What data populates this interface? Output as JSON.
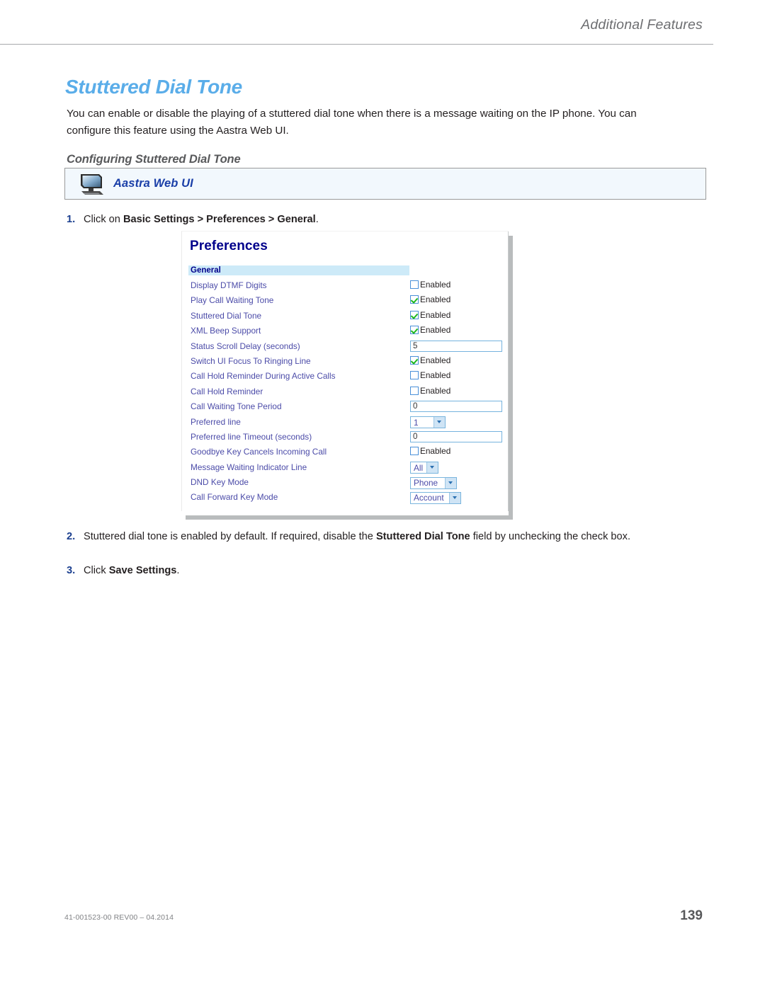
{
  "header": {
    "running_head": "Additional Features"
  },
  "page": {
    "title": "Stuttered Dial Tone",
    "intro": "You can enable or disable the playing of a stuttered dial tone when there is a message waiting on the IP phone. You can configure this feature using the Aastra Web UI.",
    "sub_head": "Configuring Stuttered Dial Tone"
  },
  "callout": {
    "icon": "computer-monitor-icon",
    "label": "Aastra Web UI"
  },
  "steps": [
    {
      "num": "1.",
      "parts": [
        {
          "text": "Click on ",
          "bold": false
        },
        {
          "text": "Basic Settings > Preferences > General",
          "bold": true
        },
        {
          "text": ".",
          "bold": false
        }
      ]
    },
    {
      "num": "2.",
      "parts": [
        {
          "text": "Stuttered dial tone is enabled by default. If required, disable the ",
          "bold": false
        },
        {
          "text": "Stuttered Dial Tone",
          "bold": true
        },
        {
          "text": " field by unchecking the check box.",
          "bold": false
        }
      ]
    },
    {
      "num": "3.",
      "parts": [
        {
          "text": "Click ",
          "bold": false
        },
        {
          "text": "Save Settings",
          "bold": true
        },
        {
          "text": ".",
          "bold": false
        }
      ]
    }
  ],
  "step1": {
    "num": "1.",
    "pre": "Click on ",
    "bold": "Basic Settings > Preferences > General",
    "post": "."
  },
  "step2": {
    "num": "2.",
    "pre": "Stuttered dial tone is enabled by default. If required, disable the ",
    "bold": "Stuttered Dial Tone",
    "post": " field by unchecking the check box."
  },
  "step3": {
    "num": "3.",
    "pre": "Click ",
    "bold": "Save Settings",
    "post": "."
  },
  "screenshot": {
    "title": "Preferences",
    "section": "General",
    "enabled_label": "Enabled",
    "rows": [
      {
        "label": "Display DTMF Digits",
        "type": "checkbox",
        "checked": false,
        "value": "Enabled"
      },
      {
        "label": "Play Call Waiting Tone",
        "type": "checkbox",
        "checked": true,
        "value": "Enabled"
      },
      {
        "label": "Stuttered Dial Tone",
        "type": "checkbox",
        "checked": true,
        "value": "Enabled"
      },
      {
        "label": "XML Beep Support",
        "type": "checkbox",
        "checked": true,
        "value": "Enabled"
      },
      {
        "label": "Status Scroll Delay (seconds)",
        "type": "text",
        "value": "5"
      },
      {
        "label": "Switch UI Focus To Ringing Line",
        "type": "checkbox",
        "checked": true,
        "value": "Enabled"
      },
      {
        "label": "Call Hold Reminder During Active Calls",
        "type": "checkbox",
        "checked": false,
        "value": "Enabled"
      },
      {
        "label": "Call Hold Reminder",
        "type": "checkbox",
        "checked": false,
        "value": "Enabled"
      },
      {
        "label": "Call Waiting Tone Period",
        "type": "text",
        "value": "0"
      },
      {
        "label": "Preferred line",
        "type": "select",
        "value": "1",
        "width": "w-line"
      },
      {
        "label": "Preferred line Timeout (seconds)",
        "type": "text",
        "value": "0"
      },
      {
        "label": "Goodbye Key Cancels Incoming Call",
        "type": "checkbox",
        "checked": false,
        "value": "Enabled"
      },
      {
        "label": "Message Waiting Indicator Line",
        "type": "select",
        "value": "All",
        "width": "w-all"
      },
      {
        "label": "DND Key Mode",
        "type": "select",
        "value": "Phone",
        "width": "w-phone"
      },
      {
        "label": "Call Forward Key Mode",
        "type": "select",
        "value": "Account",
        "width": "w-acct"
      }
    ]
  },
  "footer": {
    "doc_code": "41-001523-00 REV00 – 04.2014",
    "page_number": "139"
  },
  "colors": {
    "heading_blue": "#5aade9",
    "callout_blue": "#1a3fa8",
    "screenshot_title_blue": "#00008b",
    "section_bar": "#cdeaf8",
    "step_number": "#1b3f8f",
    "check_green": "#1db81d"
  }
}
